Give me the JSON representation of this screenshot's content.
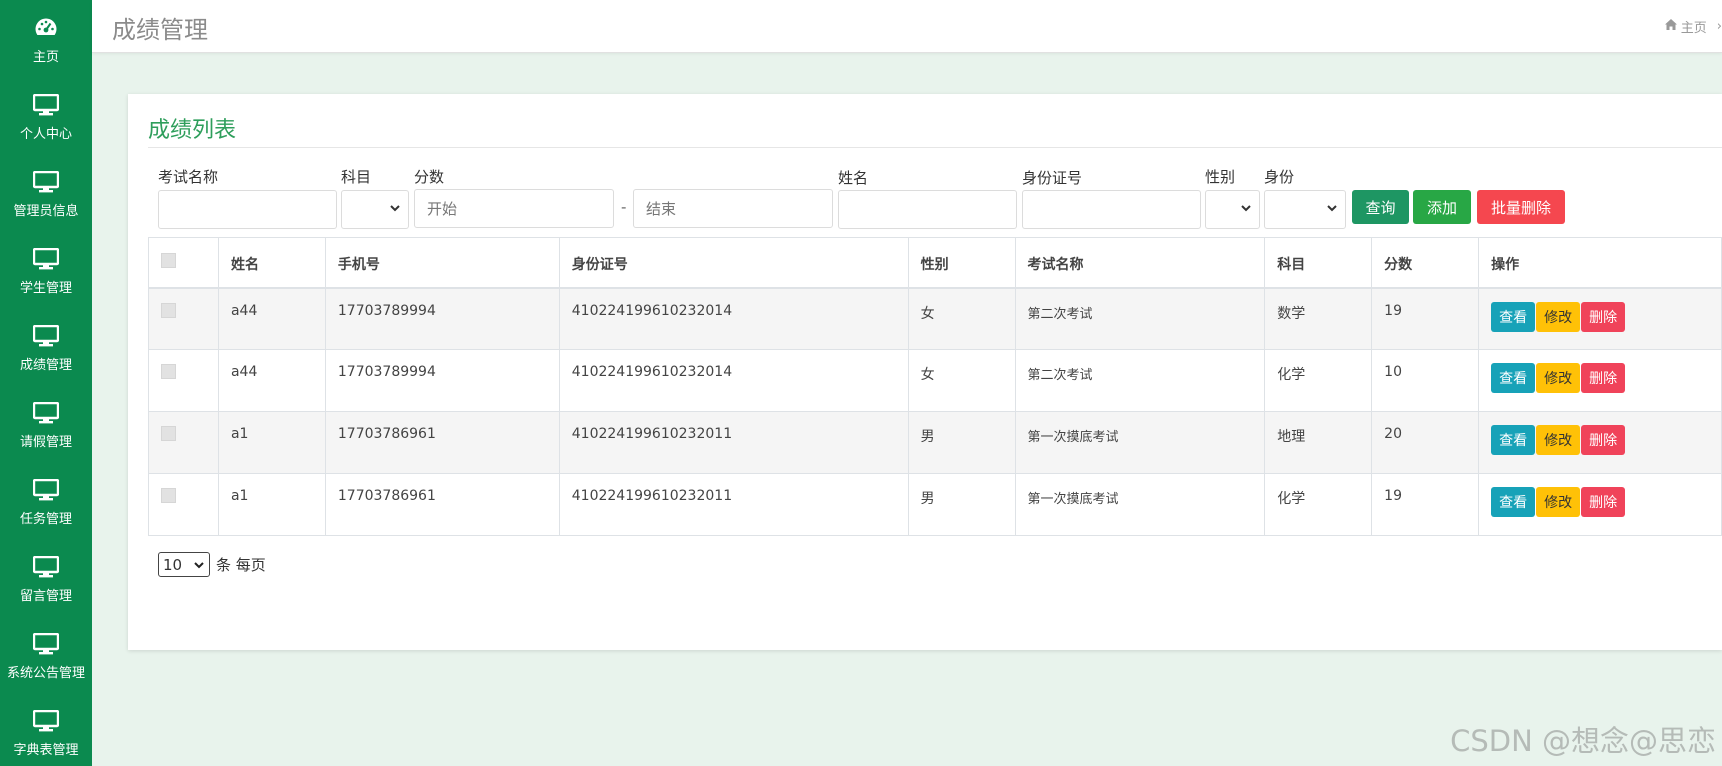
{
  "sidebar": {
    "items": [
      {
        "label": "主页",
        "icon": "dashboard-icon"
      },
      {
        "label": "个人中心",
        "icon": "monitor-icon"
      },
      {
        "label": "管理员信息",
        "icon": "monitor-icon"
      },
      {
        "label": "学生管理",
        "icon": "monitor-icon"
      },
      {
        "label": "成绩管理",
        "icon": "monitor-icon"
      },
      {
        "label": "请假管理",
        "icon": "monitor-icon"
      },
      {
        "label": "任务管理",
        "icon": "monitor-icon"
      },
      {
        "label": "留言管理",
        "icon": "monitor-icon"
      },
      {
        "label": "系统公告管理",
        "icon": "monitor-icon"
      },
      {
        "label": "字典表管理",
        "icon": "monitor-icon"
      }
    ]
  },
  "header": {
    "title": "成绩管理",
    "breadcrumb_home": "主页",
    "breadcrumb_sep": "›"
  },
  "card": {
    "title": "成绩列表"
  },
  "filters": {
    "exam_name_label": "考试名称",
    "subject_label": "科目",
    "score_label": "分数",
    "score_start_placeholder": "开始",
    "score_dash": "-",
    "score_end_placeholder": "结束",
    "name_label": "姓名",
    "idcard_label": "身份证号",
    "gender_label": "性别",
    "identity_label": "身份"
  },
  "buttons": {
    "search": "查询",
    "add": "添加",
    "batch_delete": "批量删除"
  },
  "table": {
    "headers": [
      "姓名",
      "手机号",
      "身份证号",
      "性别",
      "考试名称",
      "科目",
      "分数",
      "操作"
    ],
    "rows": [
      {
        "name": "a44",
        "phone": "17703789994",
        "idcard": "410224199610232014",
        "gender": "女",
        "exam": "第二次考试",
        "subject": "数学",
        "score": "19"
      },
      {
        "name": "a44",
        "phone": "17703789994",
        "idcard": "410224199610232014",
        "gender": "女",
        "exam": "第二次考试",
        "subject": "化学",
        "score": "10"
      },
      {
        "name": "a1",
        "phone": "17703786961",
        "idcard": "410224199610232011",
        "gender": "男",
        "exam": "第一次摸底考试",
        "subject": "地理",
        "score": "20"
      },
      {
        "name": "a1",
        "phone": "17703786961",
        "idcard": "410224199610232011",
        "gender": "男",
        "exam": "第一次摸底考试",
        "subject": "化学",
        "score": "19"
      }
    ],
    "actions": {
      "view": "查看",
      "edit": "修改",
      "delete": "删除"
    }
  },
  "pager": {
    "page_size": "10",
    "suffix": "条 每页"
  },
  "watermark": "CSDN @想念@思恋",
  "colors": {
    "sidebar_bg": "#0b8a4f",
    "title_green": "#2e9e5b",
    "search_btn": "#1e9663",
    "add_btn": "#28a745",
    "batch_delete_btn": "#f5474f",
    "view_btn": "#17a2b8",
    "edit_btn": "#ffc107",
    "delete_btn": "#f0435a"
  }
}
